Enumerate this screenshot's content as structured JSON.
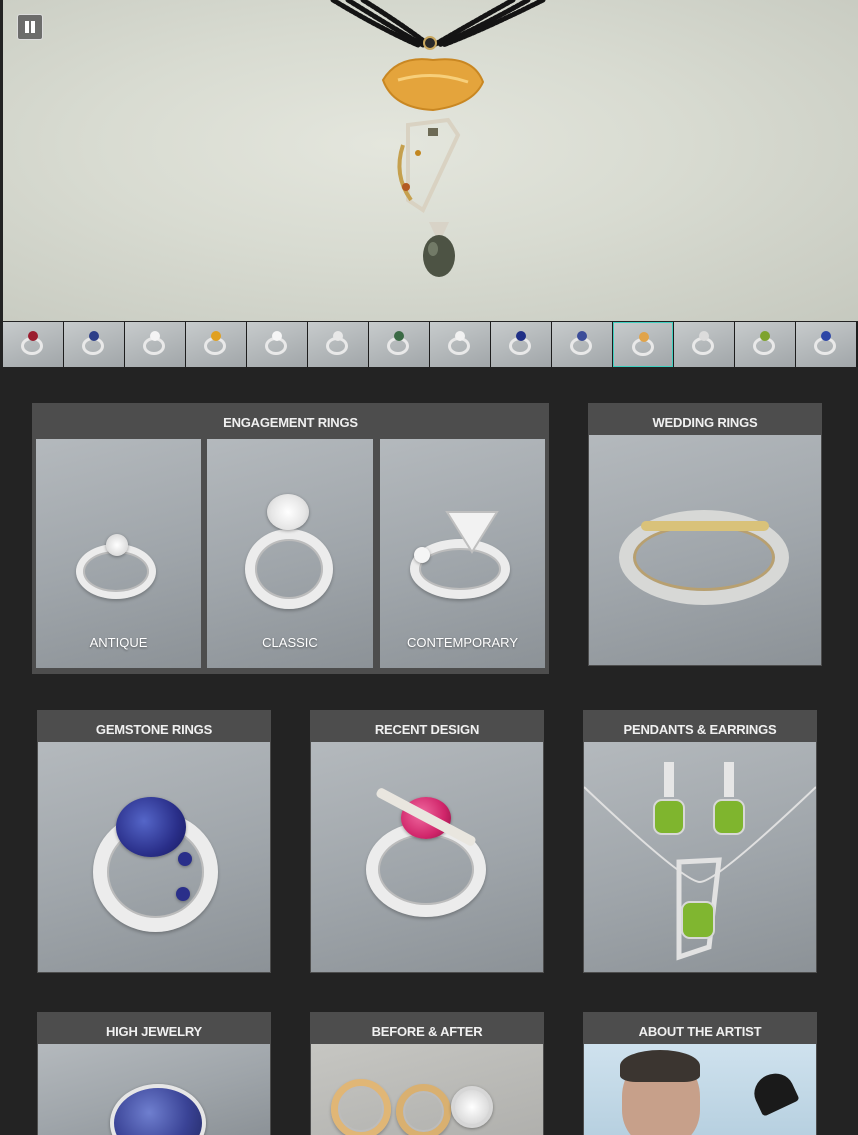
{
  "slideshow": {
    "pause_label": "Pause",
    "thumbnails": [
      {
        "icon": "ruby-ring-thumb",
        "gem": "#9b1c2e"
      },
      {
        "icon": "sapphire-ring-thumb",
        "gem": "#2d3f88"
      },
      {
        "icon": "diamond-ring-thumb",
        "gem": "#f4f4f4"
      },
      {
        "icon": "citrine-ring-thumb",
        "gem": "#e0a020"
      },
      {
        "icon": "diamond-ring-thumb",
        "gem": "#f6f6f6"
      },
      {
        "icon": "band-ring-thumb",
        "gem": "#e8e8e8"
      },
      {
        "icon": "green-ring-thumb",
        "gem": "#3b6a45"
      },
      {
        "icon": "diamond-ring-thumb",
        "gem": "#f2f2f2"
      },
      {
        "icon": "sapphire-ring-thumb",
        "gem": "#1f2f86"
      },
      {
        "icon": "sapphire-ring-thumb",
        "gem": "#3c4d99"
      },
      {
        "icon": "pearl-pendant-thumb",
        "gem": "#e1a44a"
      },
      {
        "icon": "pendant-thumb",
        "gem": "#dcdcdc"
      },
      {
        "icon": "peridot-earrings-thumb",
        "gem": "#7ea32e"
      },
      {
        "icon": "sapphire-pendant-thumb",
        "gem": "#2d46a6"
      }
    ],
    "active_index": 10
  },
  "engagement": {
    "title": "ENGAGEMENT RINGS",
    "tiles": [
      {
        "label": "ANTIQUE"
      },
      {
        "label": "CLASSIC"
      },
      {
        "label": "CONTEMPORARY"
      }
    ]
  },
  "wedding": {
    "title": "WEDDING RINGS"
  },
  "gemstone": {
    "title": "GEMSTONE RINGS"
  },
  "recent": {
    "title": "RECENT DESIGN"
  },
  "pendants": {
    "title": "PENDANTS & EARRINGS"
  },
  "high": {
    "title": "HIGH JEWELRY"
  },
  "before": {
    "title": "BEFORE & AFTER"
  },
  "artist": {
    "title": "ABOUT THE ARTIST"
  },
  "colors": {
    "page_bg": "#232323",
    "panel_bg": "#4d4d4d",
    "active_thumb_border": "#3fd0c0"
  }
}
